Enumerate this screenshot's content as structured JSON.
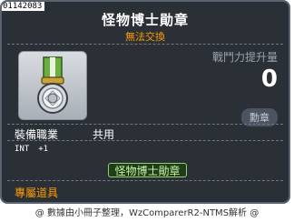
{
  "item": {
    "id": "01142083",
    "name": "怪物博士勛章",
    "trade_status": "無法交換",
    "stat_label": "戰鬥力提升量",
    "stat_value": "0",
    "category": "勳章",
    "icon": "medal-icon",
    "job_label": "裝備職業",
    "job_value": "共用",
    "stats": [
      {
        "name": "INT",
        "value": "+1"
      }
    ],
    "medal_button_label": "怪物博士勛章",
    "exclusive_label": "專屬道具"
  },
  "footer": {
    "text": "@ 數據由小冊子整理，WzComparerR2-NTMS解析 @"
  },
  "colors": {
    "background": "#2b3036",
    "accent_orange": "#ff9a00",
    "button_border": "#8fd26b",
    "button_text": "#c9f5a5"
  }
}
